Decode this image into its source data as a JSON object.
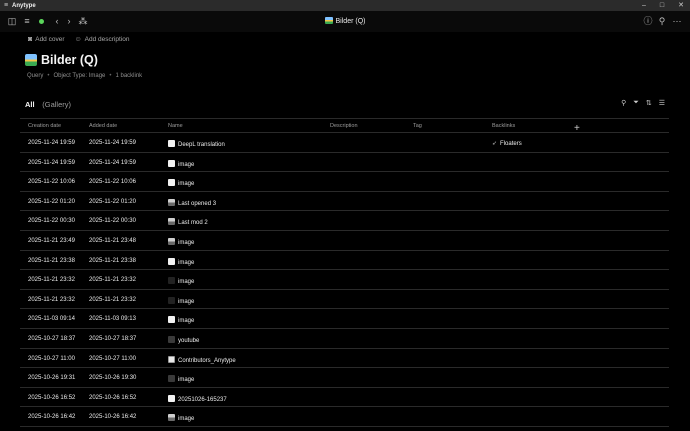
{
  "window": {
    "app_name": "Anytype"
  },
  "toolbar": {
    "page_title": "Bilder (Q)"
  },
  "header": {
    "add_cover": "Add cover",
    "add_description": "Add description",
    "title": "Bilder (Q)",
    "meta": {
      "type": "Query",
      "object_type": "Object Type: Image",
      "backlinks": "1 backlink"
    }
  },
  "view": {
    "tab_all": "All",
    "tab_gallery": "(Gallery)"
  },
  "table": {
    "columns": [
      "Creation date",
      "Added date",
      "Name",
      "Description",
      "Tag",
      "Backlinks"
    ],
    "rows": [
      {
        "created": "2025-11-24 19:59",
        "added": "2025-11-24 19:59",
        "name": "DeepL translation",
        "icon": "white",
        "backlink": "Floaters"
      },
      {
        "created": "2025-11-24 19:59",
        "added": "2025-11-24 19:59",
        "name": "image",
        "icon": "white",
        "backlink": ""
      },
      {
        "created": "2025-11-22 10:06",
        "added": "2025-11-22 10:06",
        "name": "image",
        "icon": "white",
        "backlink": ""
      },
      {
        "created": "2025-11-22 01:20",
        "added": "2025-11-22 01:20",
        "name": "Last opened 3",
        "icon": "pic",
        "backlink": ""
      },
      {
        "created": "2025-11-22 00:30",
        "added": "2025-11-22 00:30",
        "name": "Last mod 2",
        "icon": "pic",
        "backlink": ""
      },
      {
        "created": "2025-11-21 23:49",
        "added": "2025-11-21 23:48",
        "name": "image",
        "icon": "pic",
        "backlink": ""
      },
      {
        "created": "2025-11-21 23:38",
        "added": "2025-11-21 23:38",
        "name": "image",
        "icon": "white",
        "backlink": ""
      },
      {
        "created": "2025-11-21 23:32",
        "added": "2025-11-21 23:32",
        "name": "image",
        "icon": "dark",
        "backlink": ""
      },
      {
        "created": "2025-11-21 23:32",
        "added": "2025-11-21 23:32",
        "name": "image",
        "icon": "dark",
        "backlink": ""
      },
      {
        "created": "2025-11-03 09:14",
        "added": "2025-11-03 09:13",
        "name": "image",
        "icon": "white",
        "backlink": ""
      },
      {
        "created": "2025-10-27 18:37",
        "added": "2025-10-27 18:37",
        "name": "youtube",
        "icon": "gray",
        "backlink": ""
      },
      {
        "created": "2025-10-27 11:00",
        "added": "2025-10-27 11:00",
        "name": "Contributors_Anytype",
        "icon": "doc",
        "backlink": ""
      },
      {
        "created": "2025-10-26 19:31",
        "added": "2025-10-26 19:30",
        "name": "image",
        "icon": "gray",
        "backlink": ""
      },
      {
        "created": "2025-10-26 16:52",
        "added": "2025-10-26 16:52",
        "name": "20251026-165237",
        "icon": "white",
        "backlink": ""
      },
      {
        "created": "2025-10-26 16:42",
        "added": "2025-10-26 16:42",
        "name": "image",
        "icon": "pic",
        "backlink": ""
      }
    ]
  }
}
